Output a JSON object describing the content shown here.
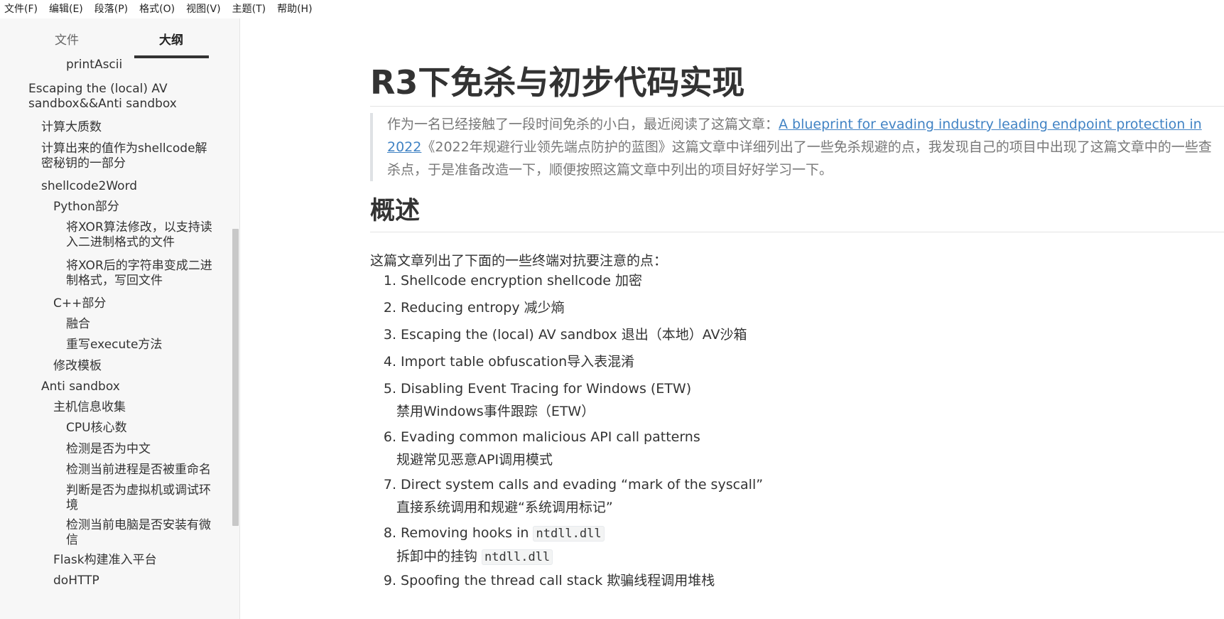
{
  "menu": [
    "文件(F)",
    "编辑(E)",
    "段落(P)",
    "格式(O)",
    "视图(V)",
    "主题(T)",
    "帮助(H)"
  ],
  "sidebar": {
    "tabs": {
      "files": "文件",
      "outline": "大纲"
    },
    "outline": [
      {
        "label": "printAscii",
        "level": 4
      },
      {
        "label": "Escaping the (local) AV sandbox&&Anti sandbox",
        "level": 2
      },
      {
        "label": "计算大质数",
        "level": 3
      },
      {
        "label": "计算出来的值作为shellcode解密秘钥的一部分",
        "level": 3
      },
      {
        "label": "shellcode2Word",
        "level": 3
      },
      {
        "label": "Python部分",
        "level": 4
      },
      {
        "label": "将XOR算法修改，以支持读入二进制格式的文件",
        "level": 5
      },
      {
        "label": "将XOR后的字符串变成二进制格式，写回文件",
        "level": 5
      },
      {
        "label": "C++部分",
        "level": 4
      },
      {
        "label": "融合",
        "level": 5
      },
      {
        "label": "重写execute方法",
        "level": 5
      },
      {
        "label": "修改模板",
        "level": 4
      },
      {
        "label": "Anti sandbox",
        "level": 3
      },
      {
        "label": "主机信息收集",
        "level": 4
      },
      {
        "label": "CPU核心数",
        "level": 5
      },
      {
        "label": "检测是否为中文",
        "level": 5
      },
      {
        "label": "检测当前进程是否被重命名",
        "level": 5
      },
      {
        "label": "判断是否为虚拟机或调试环境",
        "level": 5
      },
      {
        "label": "检测当前电脑是否安装有微信",
        "level": 5
      },
      {
        "label": "Flask构建准入平台",
        "level": 4
      },
      {
        "label": "doHTTP",
        "level": 4
      }
    ]
  },
  "doc": {
    "title": "R3下免杀与初步代码实现",
    "quote_prefix": "作为一名已经接触了一段时间免杀的小白，最近阅读了这篇文章：",
    "quote_link": "A blueprint for evading industry leading endpoint protection in 2022",
    "quote_suffix": "《2022年规避行业领先端点防护的蓝图》这篇文章中详细列出了一些免杀规避的点，我发现自己的项目中出现了这篇文章中的一些查杀点，于是准备改造一下，顺便按照这篇文章中列出的项目好好学习一下。",
    "section_heading": "概述",
    "intro": "这篇文章列出了下面的一些终端对抗要注意的点：",
    "items": [
      {
        "num": "1.",
        "text": "Shellcode encryption shellcode 加密"
      },
      {
        "num": "2.",
        "text": "Reducing entropy 减少熵"
      },
      {
        "num": "3.",
        "text": "Escaping the (local) AV sandbox 退出（本地）AV沙箱"
      },
      {
        "num": "4.",
        "text": "Import table obfuscation导入表混淆"
      },
      {
        "num": "5.",
        "text": "Disabling Event Tracing for Windows (ETW)",
        "sub": "禁用Windows事件跟踪（ETW）"
      },
      {
        "num": "6.",
        "text": "Evading common malicious API call patterns",
        "sub": "规避常见恶意API调用模式"
      },
      {
        "num": "7.",
        "text": "Direct system calls and evading “mark of the syscall”",
        "sub": "直接系统调用和规避“系统调用标记”"
      },
      {
        "num": "8.",
        "text": "Removing hooks in ",
        "code": "ntdll.dll",
        "sub": "拆卸中的挂钩 ",
        "sub_code": "ntdll.dll"
      },
      {
        "num": "9.",
        "text": "Spoofing the thread call stack 欺骗线程调用堆栈"
      }
    ]
  }
}
